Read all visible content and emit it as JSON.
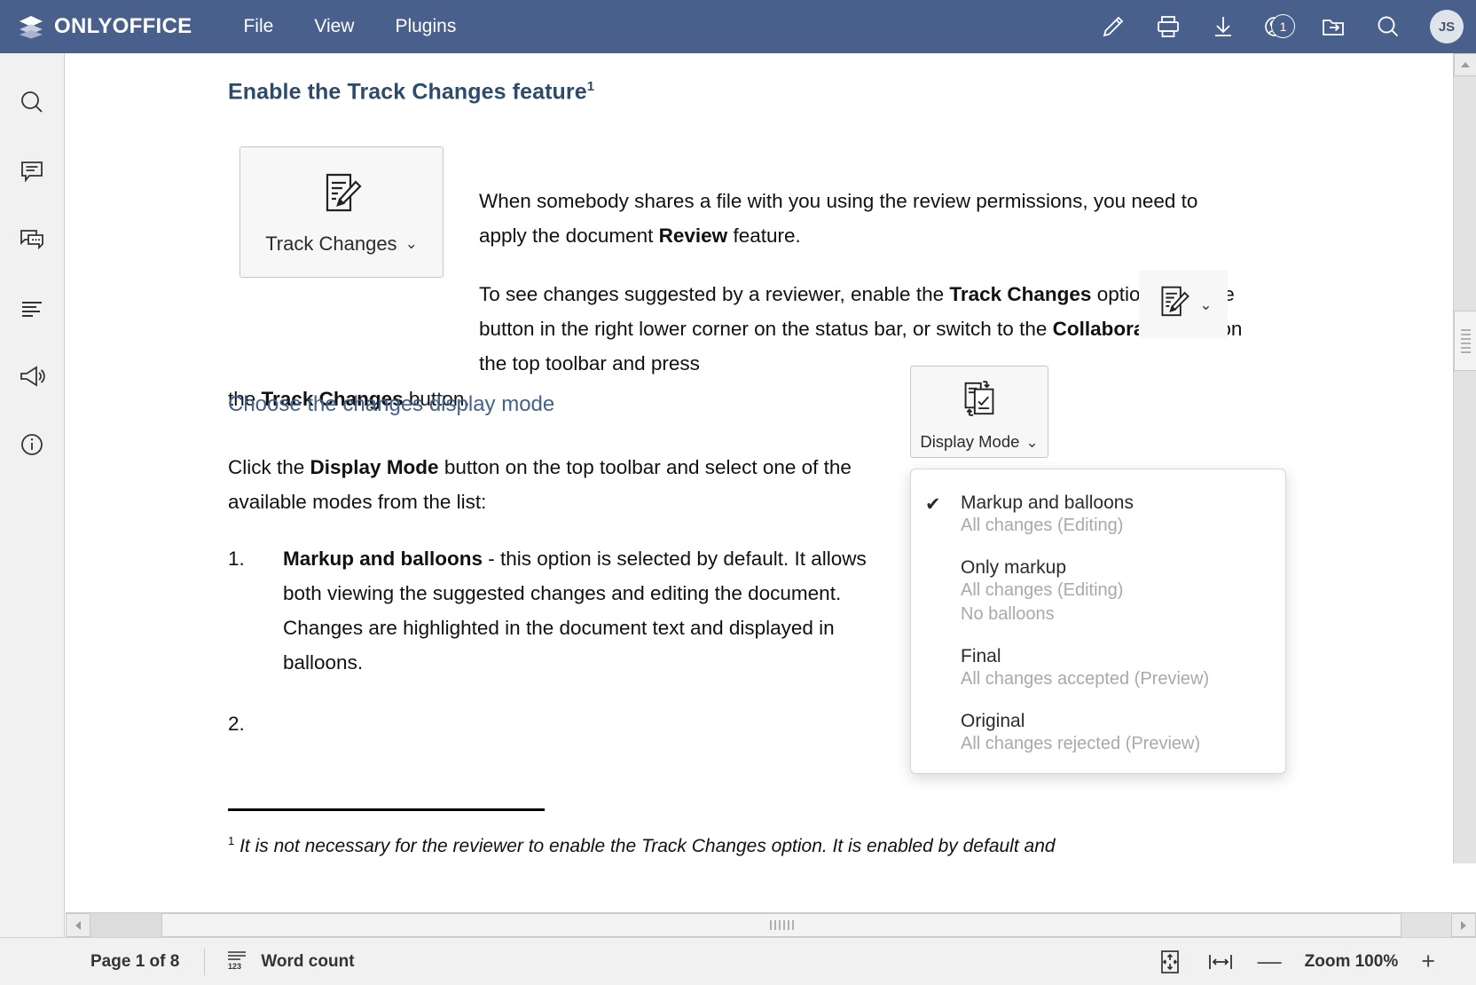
{
  "app": {
    "brand": "ONLYOFFICE",
    "brand_logo_icon": "layers-icon",
    "accent_color": "#49608c",
    "heading_color": "#2e4b6b"
  },
  "menu": [
    {
      "label": "File",
      "name": "menu-item-file"
    },
    {
      "label": "View",
      "name": "menu-item-view"
    },
    {
      "label": "Plugins",
      "name": "menu-item-plugins"
    }
  ],
  "toolbar_right": [
    {
      "icon": "pencil-icon",
      "label": "Edit"
    },
    {
      "icon": "print-icon",
      "label": "Print"
    },
    {
      "icon": "download-icon",
      "label": "Download"
    },
    {
      "icon": "users-icon",
      "label": "Collaborators",
      "badge": "1"
    },
    {
      "icon": "open-location-icon",
      "label": "Open file location"
    },
    {
      "icon": "search-icon",
      "label": "Search"
    }
  ],
  "avatar": {
    "initials": "JS"
  },
  "left_rail": [
    {
      "icon": "search-icon",
      "label": "Search"
    },
    {
      "icon": "comments-icon",
      "label": "Comments"
    },
    {
      "icon": "chat-icon",
      "label": "Chat"
    },
    {
      "icon": "headings-icon",
      "label": "Headings"
    },
    {
      "icon": "feedback-icon",
      "label": "Feedback & Support"
    },
    {
      "icon": "info-icon",
      "label": "About"
    }
  ],
  "document": {
    "heading1": "Enable the Track Changes feature",
    "heading1_sup": "1",
    "heading2": "Choose the changes display mode",
    "paragraph1_a": "When somebody shares a file with you using the review permissions, you need to apply the document ",
    "paragraph1_bold": "Review",
    "paragraph1_b": " feature.",
    "paragraph2_a": "To see changes suggested by a reviewer, enable the ",
    "paragraph2_bold1": "Track Changes",
    "paragraph2_b": " option: click the button in the right lower corner on the status bar, or switch to the ",
    "paragraph2_bold2": "Collaboration",
    "paragraph2_c": " tab on the top toolbar and press",
    "paragraph2_tail_a": "the ",
    "paragraph2_tail_bold": "Track Changes",
    "paragraph2_tail_b": " button.",
    "paragraph3_a": "Click the ",
    "paragraph3_bold": "Display Mode",
    "paragraph3_b": " button on the top toolbar and select one of the available modes from the list:",
    "list": [
      {
        "number": "1.",
        "bold": "Markup and balloons",
        "text": " - this option is selected by default. It allows both viewing the suggested changes and editing the document. Changes are highlighted in the document text and displayed in balloons."
      },
      {
        "number": "2.",
        "bold": "",
        "text": ""
      }
    ],
    "footnote_marker": "1",
    "footnote_text": "It is not necessary for the reviewer to enable the Track Changes option. It is enabled by default and"
  },
  "figures": {
    "track_changes_button": {
      "label": "Track Changes",
      "icon": "track-changes-icon",
      "chevron": "⌄"
    },
    "display_mode_button": {
      "label": "Display Mode",
      "icon": "display-mode-icon",
      "chevron": "⌄"
    },
    "inline_track_changes": {
      "icon": "track-changes-icon",
      "chevron": "⌄"
    }
  },
  "dropdown": {
    "items": [
      {
        "checked": true,
        "check_glyph": "✔",
        "title": "Markup and balloons",
        "sub1": "All changes (Editing)",
        "sub2": ""
      },
      {
        "checked": false,
        "check_glyph": "",
        "title": "Only markup",
        "sub1": "All changes (Editing)",
        "sub2": "No balloons"
      },
      {
        "checked": false,
        "check_glyph": "",
        "title": "Final",
        "sub1": "All changes accepted (Preview)",
        "sub2": ""
      },
      {
        "checked": false,
        "check_glyph": "",
        "title": "Original",
        "sub1": "All changes rejected (Preview)",
        "sub2": ""
      }
    ]
  },
  "statusbar": {
    "page_label": "Page 1 of 8",
    "word_count_label": "Word count",
    "word_count_icon": "word-count-123-icon",
    "fit_page_icon": "fit-to-page-icon",
    "fit_width_icon": "fit-to-width-icon",
    "zoom_out": "—",
    "zoom_label": "Zoom 100%",
    "zoom_in": "+"
  }
}
